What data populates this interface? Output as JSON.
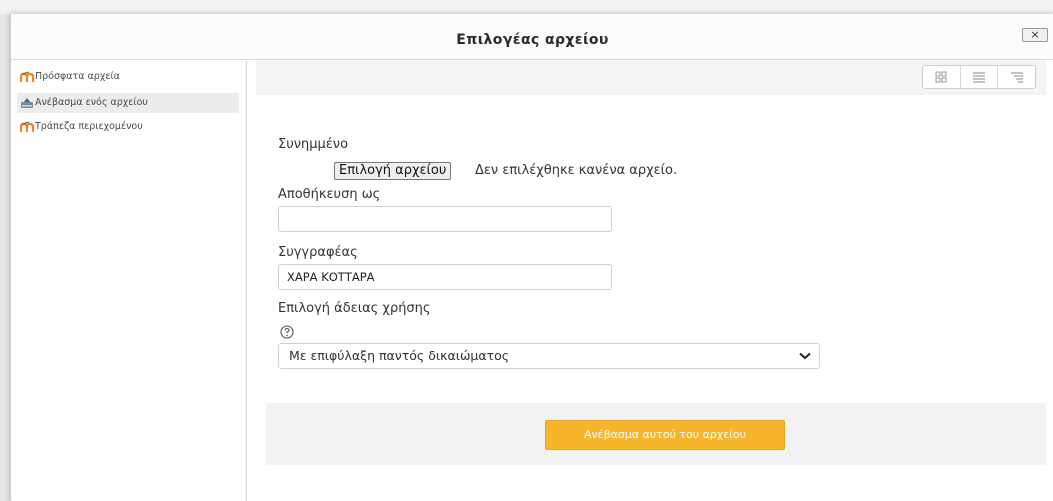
{
  "dialog": {
    "title": "Επιλογέας αρχείου",
    "close_label": "×"
  },
  "sidebar": {
    "items": [
      {
        "label": "Πρόσφατα αρχεία",
        "icon": "moodle-logo-icon"
      },
      {
        "label": "Ανέβασμα ενός αρχείου",
        "icon": "upload-file-icon"
      },
      {
        "label": "Τράπεζα περιεχομένου",
        "icon": "moodle-logo-icon"
      }
    ],
    "active_index": 1
  },
  "toolbar": {
    "view_buttons": [
      "view-icons-icon",
      "view-list-icon",
      "view-tree-icon"
    ]
  },
  "form": {
    "attachment_label": "Συνημμένο",
    "choose_file_button": "Επιλογή αρχείου",
    "no_file_text": "Δεν επιλέχθηκε κανένα αρχείο.",
    "save_as_label": "Αποθήκευση ως",
    "save_as_value": "",
    "author_label": "Συγγραφέας",
    "author_value": "ΧΑΡΑ ΚΟΤΤΑΡΑ",
    "license_label": "Επιλογή άδειας χρήσης",
    "license_value": "Με επιφύλαξη παντός δικαιώματος",
    "upload_button": "Ανέβασμα αυτού του αρχείου"
  },
  "colors": {
    "accent": "#f7b52c",
    "moodle_orange": "#f98012"
  }
}
